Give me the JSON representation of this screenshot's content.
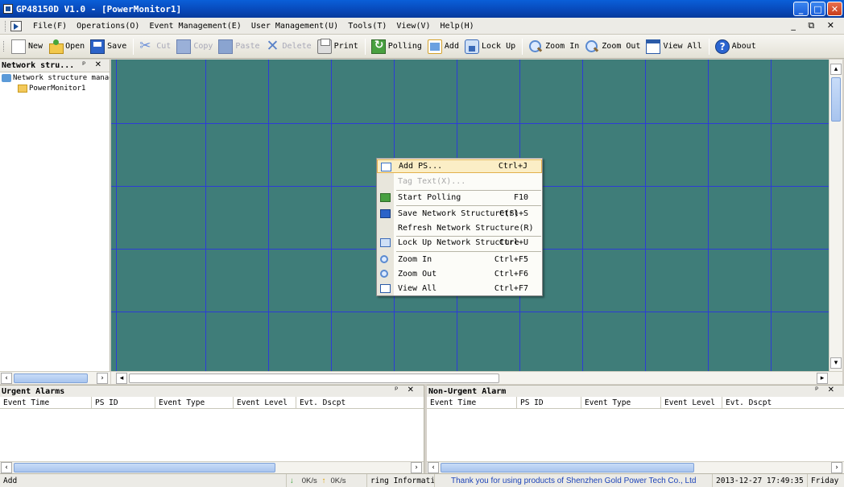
{
  "window": {
    "title": "GP48150D V1.0 - [PowerMonitor1]",
    "buttons": {
      "minimize": "_",
      "maximize": "□",
      "close": "✕"
    }
  },
  "menubar": {
    "items": [
      "File(F)",
      "Operations(O)",
      "Event Management(E)",
      "User Management(U)",
      "Tools(T)",
      "View(V)",
      "Help(H)"
    ],
    "mdi_controls": "_ ⧉ ✕"
  },
  "toolbar": {
    "buttons": [
      {
        "label": "New",
        "icon": "new-icon",
        "enabled": true
      },
      {
        "label": "Open",
        "icon": "open-icon",
        "enabled": true
      },
      {
        "label": "Save",
        "icon": "save-icon",
        "enabled": true
      },
      {
        "label": "Cut",
        "icon": "cut-icon",
        "enabled": false
      },
      {
        "label": "Copy",
        "icon": "copy-icon",
        "enabled": false
      },
      {
        "label": "Paste",
        "icon": "paste-icon",
        "enabled": false
      },
      {
        "label": "Delete",
        "icon": "delete-icon",
        "enabled": false
      },
      {
        "label": "Print",
        "icon": "print-icon",
        "enabled": true
      },
      {
        "label": "Polling",
        "icon": "polling-icon",
        "enabled": true
      },
      {
        "label": "Add",
        "icon": "add-icon",
        "enabled": true
      },
      {
        "label": "Lock Up",
        "icon": "lock-icon",
        "enabled": true
      },
      {
        "label": "Zoom In",
        "icon": "zoom-in-icon",
        "enabled": true
      },
      {
        "label": "Zoom Out",
        "icon": "zoom-out-icon",
        "enabled": true
      },
      {
        "label": "View All",
        "icon": "view-all-icon",
        "enabled": true
      },
      {
        "label": "About",
        "icon": "about-icon",
        "enabled": true
      }
    ]
  },
  "left_pane": {
    "title": "Network stru...",
    "controls": "ᵖ ✕",
    "tree": {
      "root": "Network structure manag",
      "children": [
        "PowerMonitor1"
      ]
    }
  },
  "context_menu": {
    "items": [
      {
        "label": "Add PS...",
        "shortcut": "Ctrl+J",
        "icon": "add-ps-icon"
      },
      {
        "label": "Tag Text(X)...",
        "shortcut": "",
        "icon": ""
      },
      {
        "label": "Start Polling",
        "shortcut": "F10",
        "icon": "polling-icon"
      },
      {
        "label": "Save Network Structure(S)",
        "shortcut": "Ctrl+S",
        "icon": "save-icon"
      },
      {
        "label": "Refresh Network Structure(R)",
        "shortcut": "",
        "icon": ""
      },
      {
        "label": "Lock Up Network Structure",
        "shortcut": "Ctrl+U",
        "icon": "lock-icon"
      },
      {
        "label": "Zoom In",
        "shortcut": "Ctrl+F5",
        "icon": "zoom-in-icon"
      },
      {
        "label": "Zoom Out",
        "shortcut": "Ctrl+F6",
        "icon": "zoom-out-icon"
      },
      {
        "label": "View All",
        "shortcut": "Ctrl+F7",
        "icon": "view-all-icon"
      }
    ]
  },
  "urgent_alarms": {
    "title": "Urgent Alarms",
    "controls": "ᵖ ✕",
    "columns": [
      "Event Time",
      "PS ID",
      "Event Type",
      "Event Level",
      "Evt. Dscpt"
    ]
  },
  "nonurgent_alarms": {
    "title": "Non-Urgent Alarm",
    "controls": "ᵖ ✕",
    "columns": [
      "Event Time",
      "PS ID",
      "Event Type",
      "Event Level",
      "Evt. Dscpt"
    ]
  },
  "statusbar": {
    "left": "Add",
    "down_speed": "0K/s",
    "up_speed": "0K/s",
    "info": "ring Information.",
    "thanks": "Thank you for using products of Shenzhen Gold Power Tech Co., Ltd",
    "datetime": "2013-12-27 17:49:35",
    "weekday": "Friday"
  },
  "colors": {
    "canvas_bg": "#3f7d79",
    "grid_line": "#2d3cd6",
    "titlebar": "#0a5fd8",
    "highlight": "#fbeec6"
  }
}
